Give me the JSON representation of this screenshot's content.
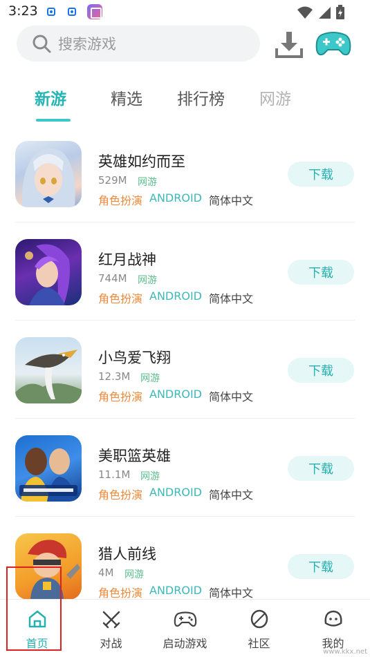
{
  "status_bar": {
    "time": "3:23"
  },
  "search": {
    "placeholder": "搜索游戏"
  },
  "tabs": [
    {
      "label": "新游",
      "active": true
    },
    {
      "label": "精选",
      "active": false
    },
    {
      "label": "排行榜",
      "active": false
    },
    {
      "label": "网游",
      "active": false
    }
  ],
  "games": [
    {
      "name": "英雄如约而至",
      "size": "529M",
      "type": "网游",
      "genre": "角色扮演",
      "platform": "ANDROID",
      "language": "简体中文",
      "button": "下载"
    },
    {
      "name": "红月战神",
      "size": "744M",
      "type": "网游",
      "genre": "角色扮演",
      "platform": "ANDROID",
      "language": "简体中文",
      "button": "下载"
    },
    {
      "name": "小鸟爱飞翔",
      "size": "12.3M",
      "type": "网游",
      "genre": "角色扮演",
      "platform": "ANDROID",
      "language": "简体中文",
      "button": "下载"
    },
    {
      "name": "美职篮英雄",
      "size": "11.1M",
      "type": "网游",
      "genre": "角色扮演",
      "platform": "ANDROID",
      "language": "简体中文",
      "button": "下载"
    },
    {
      "name": "猎人前线",
      "size": "4M",
      "type": "网游",
      "genre": "角色扮演",
      "platform": "ANDROID",
      "language": "简体中文",
      "button": "下载"
    }
  ],
  "bottom_nav": [
    {
      "label": "首页",
      "icon": "home-icon",
      "active": true
    },
    {
      "label": "对战",
      "icon": "swords-icon",
      "active": false
    },
    {
      "label": "启动游戏",
      "icon": "gamepad-icon",
      "active": false
    },
    {
      "label": "社区",
      "icon": "leaf-icon",
      "active": false
    },
    {
      "label": "我的",
      "icon": "face-icon",
      "active": false
    }
  ],
  "colors": {
    "accent": "#26b5b5",
    "genre": "#f08a3c",
    "online": "#5bbf8a",
    "button_bg": "#e6f7f7"
  },
  "watermark": "www.kkx.net"
}
